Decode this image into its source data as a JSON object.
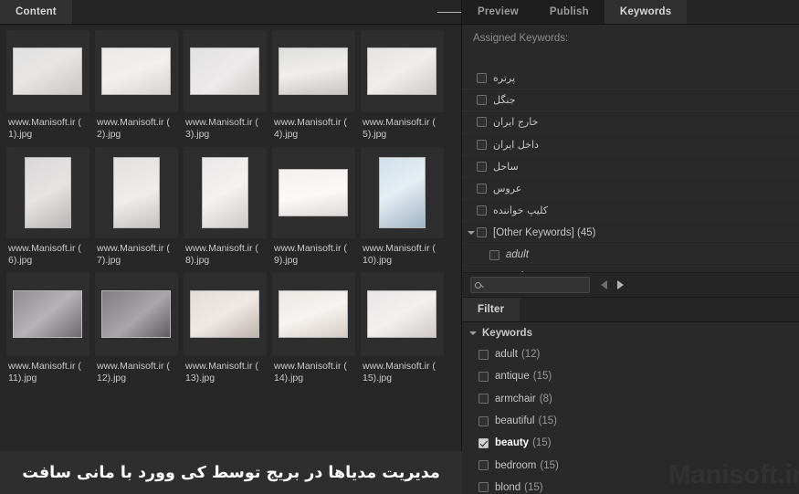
{
  "content_panel": {
    "tab_label": "Content",
    "menu_icon": "hamburger-menu-icon",
    "caption": "مدیریت مدیاها در بریج توسط کی وورد  با مانی سافت",
    "thumbnails": [
      {
        "label": "www.Manisoft.ir ( 1).jpg",
        "orientation": "landscape"
      },
      {
        "label": "www.Manisoft.ir ( 2).jpg",
        "orientation": "landscape"
      },
      {
        "label": "www.Manisoft.ir ( 3).jpg",
        "orientation": "landscape"
      },
      {
        "label": "www.Manisoft.ir ( 4).jpg",
        "orientation": "landscape"
      },
      {
        "label": "www.Manisoft.ir ( 5).jpg",
        "orientation": "landscape"
      },
      {
        "label": "www.Manisoft.ir ( 6).jpg",
        "orientation": "portrait"
      },
      {
        "label": "www.Manisoft.ir ( 7).jpg",
        "orientation": "portrait"
      },
      {
        "label": "www.Manisoft.ir ( 8).jpg",
        "orientation": "portrait"
      },
      {
        "label": "www.Manisoft.ir ( 9).jpg",
        "orientation": "landscape"
      },
      {
        "label": "www.Manisoft.ir ( 10).jpg",
        "orientation": "portrait"
      },
      {
        "label": "www.Manisoft.ir ( 11).jpg",
        "orientation": "landscape"
      },
      {
        "label": "www.Manisoft.ir ( 12).jpg",
        "orientation": "landscape"
      },
      {
        "label": "www.Manisoft.ir ( 13).jpg",
        "orientation": "landscape"
      },
      {
        "label": "www.Manisoft.ir ( 14).jpg",
        "orientation": "landscape"
      },
      {
        "label": "www.Manisoft.ir ( 15).jpg",
        "orientation": "landscape"
      }
    ]
  },
  "right_panel": {
    "tabs": [
      {
        "label": "Preview",
        "active": false
      },
      {
        "label": "Publish",
        "active": false
      },
      {
        "label": "Keywords",
        "active": true
      }
    ],
    "assigned_heading": "Assigned Keywords:",
    "assigned_keywords": [
      {
        "label": "پرتره",
        "checked": false,
        "rtl": true,
        "indent": 0
      },
      {
        "label": "جنگل",
        "checked": false,
        "rtl": true,
        "indent": 0
      },
      {
        "label": "خارج ایران",
        "checked": false,
        "rtl": true,
        "indent": 0
      },
      {
        "label": "داخل ایران",
        "checked": false,
        "rtl": true,
        "indent": 0
      },
      {
        "label": "ساحل",
        "checked": false,
        "rtl": true,
        "indent": 0
      },
      {
        "label": "عروس",
        "checked": false,
        "rtl": true,
        "indent": 0
      },
      {
        "label": "کلیپ خواننده",
        "checked": false,
        "rtl": true,
        "indent": 0
      },
      {
        "label": "[Other Keywords] (45)",
        "checked": false,
        "rtl": false,
        "indent": 0,
        "disclosure": true
      },
      {
        "label": "adult",
        "checked": false,
        "rtl": false,
        "indent": 1,
        "italic": true
      },
      {
        "label": "antique",
        "checked": false,
        "rtl": false,
        "indent": 1,
        "italic": true
      }
    ],
    "search": {
      "value": "",
      "placeholder": "",
      "icon": "search-icon"
    },
    "nav": {
      "back_icon": "arrow-left-icon",
      "forward_icon": "arrow-right-icon"
    },
    "filter_tab_label": "Filter",
    "filter_section_label": "Keywords",
    "filter_keywords": [
      {
        "name": "adult",
        "count": "(12)",
        "checked": false
      },
      {
        "name": "antique",
        "count": "(15)",
        "checked": false
      },
      {
        "name": "armchair",
        "count": "(8)",
        "checked": false
      },
      {
        "name": "beautiful",
        "count": "(15)",
        "checked": false
      },
      {
        "name": "beauty",
        "count": "(15)",
        "checked": true
      },
      {
        "name": "bedroom",
        "count": "(15)",
        "checked": false
      },
      {
        "name": "blond",
        "count": "(15)",
        "checked": false
      }
    ],
    "watermark": "Manisoft.ir"
  },
  "colors": {
    "panel_bg": "#272727",
    "tabbar_bg": "#1e1e1e",
    "active_tab_bg": "#303030",
    "text": "#c5c5c5",
    "muted_text": "#9a9a9a"
  }
}
